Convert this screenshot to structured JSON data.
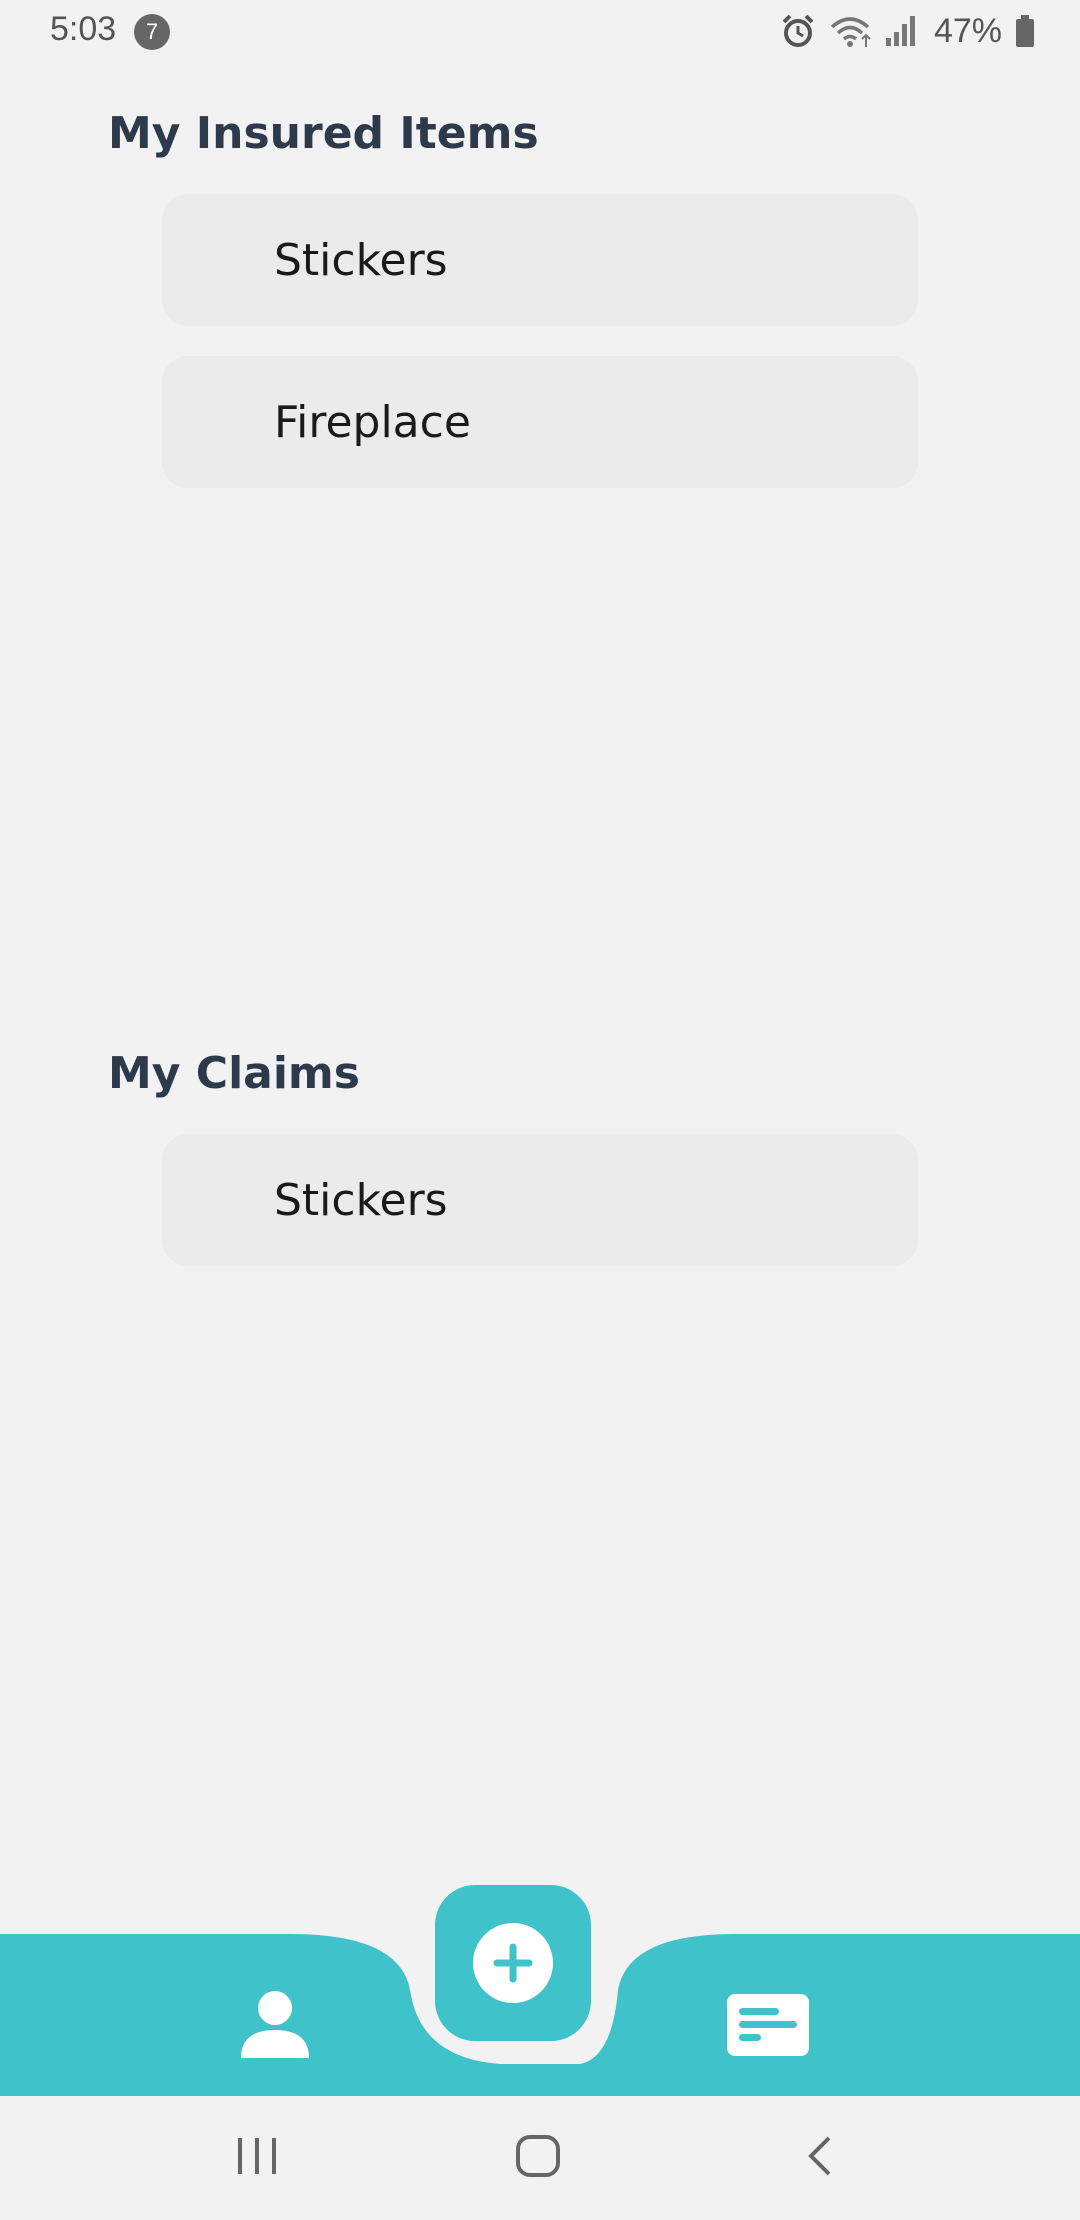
{
  "status_bar": {
    "time": "5:03",
    "notification_count": "7",
    "battery": "47%"
  },
  "insured_items": {
    "title": "My Insured Items",
    "items": [
      {
        "label": "Stickers"
      },
      {
        "label": "Fireplace"
      }
    ]
  },
  "claims": {
    "title": "My Claims",
    "items": [
      {
        "label": "Stickers"
      }
    ]
  },
  "bottom_nav": {
    "accent_color": "#40c2cb",
    "buttons": [
      {
        "icon": "person-icon"
      },
      {
        "icon": "plus-icon"
      },
      {
        "icon": "list-icon"
      }
    ]
  },
  "system_nav": {
    "buttons": [
      {
        "icon": "recent-apps-icon"
      },
      {
        "icon": "home-icon"
      },
      {
        "icon": "back-icon"
      }
    ]
  }
}
